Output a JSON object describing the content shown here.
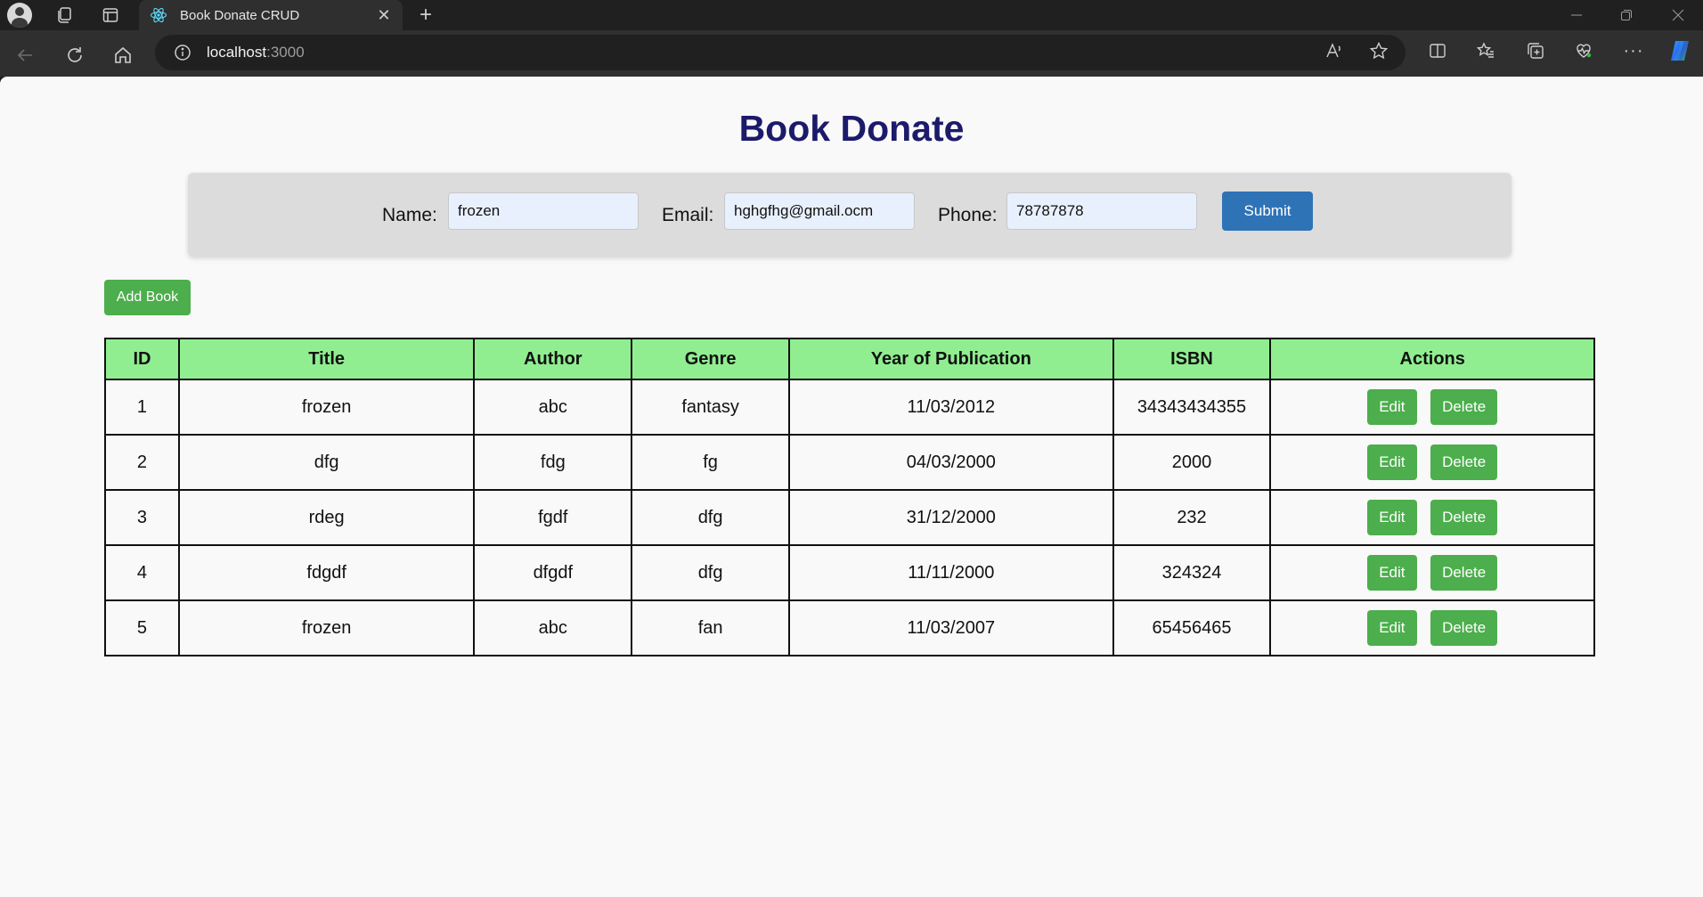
{
  "browser": {
    "tab_title": "Book Donate CRUD",
    "url_host": "localhost",
    "url_port": ":3000"
  },
  "page": {
    "title": "Book Donate",
    "form": {
      "name_label": "Name:",
      "name_value": "frozen",
      "email_label": "Email:",
      "email_value": "hghgfhg@gmail.ocm",
      "phone_label": "Phone:",
      "phone_value": "78787878",
      "submit_label": "Submit"
    },
    "add_book_label": "Add Book",
    "table": {
      "headers": [
        "ID",
        "Title",
        "Author",
        "Genre",
        "Year of Publication",
        "ISBN",
        "Actions"
      ],
      "rows": [
        {
          "id": "1",
          "title": "frozen",
          "author": "abc",
          "genre": "fantasy",
          "year": "11/03/2012",
          "isbn": "34343434355"
        },
        {
          "id": "2",
          "title": "dfg",
          "author": "fdg",
          "genre": "fg",
          "year": "04/03/2000",
          "isbn": "2000"
        },
        {
          "id": "3",
          "title": "rdeg",
          "author": "fgdf",
          "genre": "dfg",
          "year": "31/12/2000",
          "isbn": "232"
        },
        {
          "id": "4",
          "title": "fdgdf",
          "author": "dfgdf",
          "genre": "dfg",
          "year": "11/11/2000",
          "isbn": "324324"
        },
        {
          "id": "5",
          "title": "frozen",
          "author": "abc",
          "genre": "fan",
          "year": "11/03/2007",
          "isbn": "65456465"
        }
      ],
      "edit_label": "Edit",
      "delete_label": "Delete"
    }
  },
  "colors": {
    "title": "#1c1a6a",
    "submit": "#2f73b7",
    "green_button": "#4cae4c",
    "header_bg": "#90ee90"
  }
}
